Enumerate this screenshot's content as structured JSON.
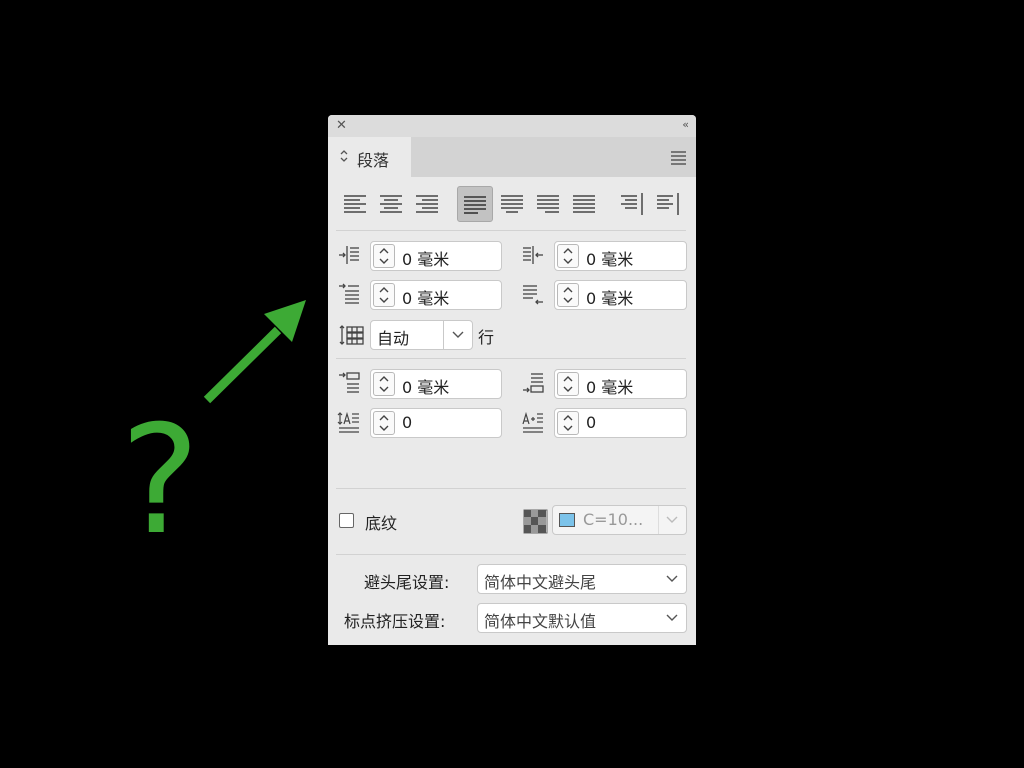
{
  "annotation": {
    "question_mark": "?",
    "arrow_color": "#3daa35"
  },
  "panel": {
    "tab_label": "段落",
    "indent": {
      "left": "0 毫米",
      "right": "0 毫米",
      "first_line": "0 毫米",
      "last_line": "0 毫米"
    },
    "grid": {
      "value": "自动",
      "suffix": "行"
    },
    "spacing": {
      "before": "0 毫米",
      "after": "0 毫米",
      "drop_cap_lines": "0",
      "drop_cap_chars": "0"
    },
    "shading": {
      "label": "底纹",
      "checked": false,
      "color_value": "C=10...",
      "swatch_color": "#7cc3ea"
    },
    "kinsoku": {
      "label": "避头尾设置:",
      "value": "简体中文避头尾"
    },
    "mojikumi": {
      "label": "标点挤压设置:",
      "value": "简体中文默认值"
    }
  }
}
